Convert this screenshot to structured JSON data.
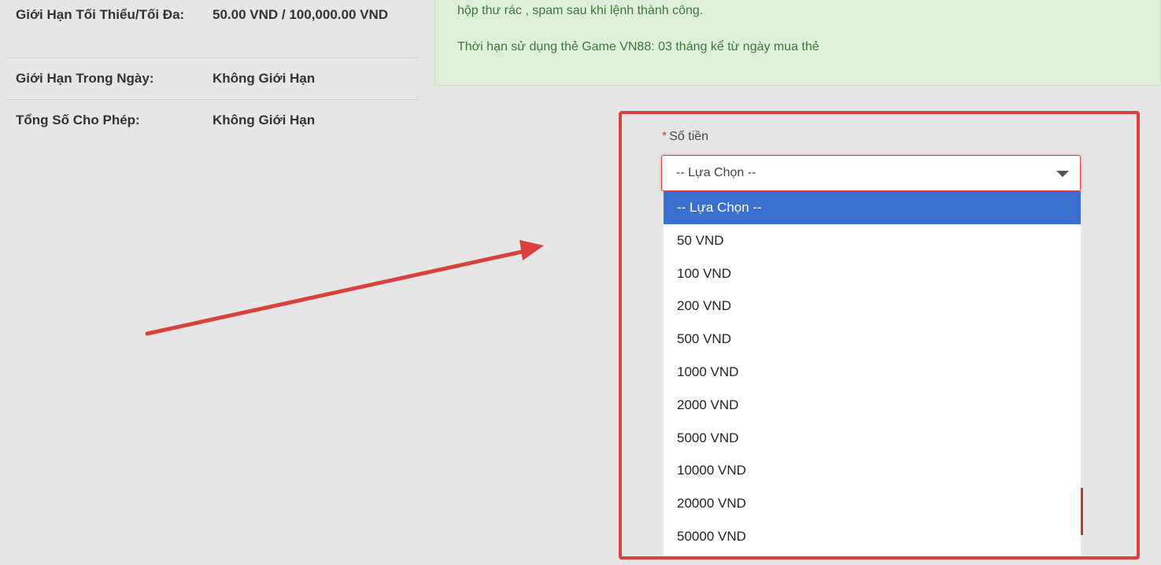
{
  "limits": [
    {
      "label": "Giới Hạn Tối Thiểu/Tối Đa:",
      "value": "50.00 VND / 100,000.00 VND"
    },
    {
      "label": "Giới Hạn Trong Ngày:",
      "value": "Không Giới Hạn"
    },
    {
      "label": "Tổng Số Cho Phép:",
      "value": "Không Giới Hạn"
    }
  ],
  "notice": {
    "line1": "hộp thư rác , spam sau khi lệnh thành công.",
    "line2": "Thời hạn sử dụng thẻ Game VN88: 03 tháng kể từ ngày mua thẻ"
  },
  "amount_field": {
    "required_mark": "*",
    "label": "Số tiền",
    "selected": "-- Lựa Chọn --"
  },
  "options": [
    "-- Lựa Chọn --",
    "50 VND",
    "100 VND",
    "200 VND",
    "500 VND",
    "1000 VND",
    "2000 VND",
    "5000 VND",
    "10000 VND",
    "20000 VND",
    "50000 VND"
  ],
  "colors": {
    "highlight": "#d9413c",
    "notice_bg": "#dff0d8",
    "notice_text": "#3c763d",
    "option_selected": "#3a6fd0"
  }
}
